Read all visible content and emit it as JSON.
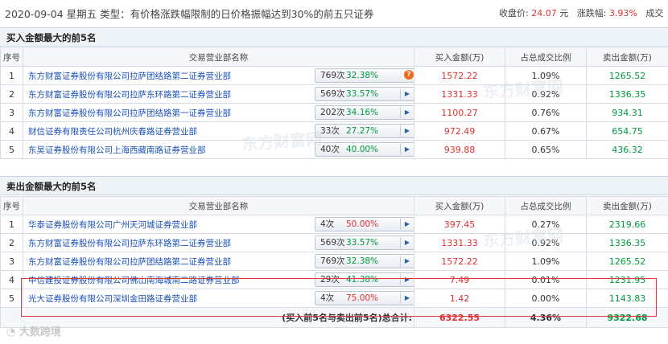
{
  "top": {
    "title": "2020-09-04 星期五 类型：有价格涨跌幅限制的日价格振幅达到30%的前五只证券",
    "close_label": "收盘价:",
    "close_value": "24.07",
    "close_unit": "元",
    "change_label": "涨跌幅:",
    "change_value": "3.93%",
    "volume_label": "成交"
  },
  "buy": {
    "heading": "买入金额最大的前5名",
    "headers": [
      "序号",
      "交易营业部名称",
      "买入金额(万)",
      "占总成交比例",
      "卖出金额(万)"
    ],
    "rows": [
      {
        "seq": "1",
        "name": "东方财富证券股份有限公司拉萨团结路第二证券营业部",
        "count": "769次",
        "pct": "32.38%",
        "buy": "1572.22",
        "ratio": "1.09%",
        "sell": "1265.52",
        "warn": true
      },
      {
        "seq": "2",
        "name": "东方财富证券股份有限公司拉萨东环路第二证券营业部",
        "count": "569次",
        "pct": "33.57%",
        "buy": "1331.33",
        "ratio": "0.92%",
        "sell": "1336.35",
        "warn": false
      },
      {
        "seq": "3",
        "name": "东方财富证券股份有限公司拉萨团结路第一证券营业部",
        "count": "202次",
        "pct": "34.16%",
        "buy": "1100.27",
        "ratio": "0.76%",
        "sell": "934.31",
        "warn": false
      },
      {
        "seq": "4",
        "name": "财信证券有限责任公司杭州庆春路证券营业部",
        "count": "33次",
        "pct": "27.27%",
        "buy": "972.49",
        "ratio": "0.67%",
        "sell": "654.75",
        "warn": false
      },
      {
        "seq": "5",
        "name": "东吴证券股份有限公司上海西藏南路证券营业部",
        "count": "40次",
        "pct": "40.00%",
        "buy": "939.88",
        "ratio": "0.65%",
        "sell": "436.32",
        "warn": false
      }
    ]
  },
  "sell": {
    "heading": "卖出金额最大的前5名",
    "headers": [
      "序号",
      "交易营业部名称",
      "买入金额(万)",
      "占总成交比例",
      "卖出金额(万)"
    ],
    "rows": [
      {
        "seq": "1",
        "name": "华泰证券股份有限公司广州天河城证券营业部",
        "count": "4次",
        "pct": "50.00%",
        "pct_red": true,
        "buy": "397.45",
        "ratio": "0.27%",
        "sell": "2319.66"
      },
      {
        "seq": "2",
        "name": "东方财富证券股份有限公司拉萨东环路第二证券营业部",
        "count": "569次",
        "pct": "33.57%",
        "pct_red": false,
        "buy": "1331.33",
        "ratio": "0.92%",
        "sell": "1336.35"
      },
      {
        "seq": "3",
        "name": "东方财富证券股份有限公司拉萨团结路第二证券营业部",
        "count": "769次",
        "pct": "32.38%",
        "pct_red": false,
        "buy": "1572.22",
        "ratio": "1.09%",
        "sell": "1265.52"
      },
      {
        "seq": "4",
        "name": "中信建投证券股份有限公司佛山南海城南二路证券营业部",
        "count": "29次",
        "pct": "41.38%",
        "pct_red": false,
        "buy": "7.49",
        "ratio": "0.01%",
        "sell": "1231.95"
      },
      {
        "seq": "5",
        "name": "光大证券股份有限公司深圳金田路证券营业部",
        "count": "4次",
        "pct": "75.00%",
        "pct_red": true,
        "buy": "1.42",
        "ratio": "0.00%",
        "sell": "1143.83"
      }
    ],
    "total_label": "(买入前5名与卖出前5名)总合计:",
    "total_buy": "6322.55",
    "total_ratio": "4.36%",
    "total_sell": "9322.68"
  },
  "watermark": "大数跨境",
  "bg_watermark": "东方财富网"
}
